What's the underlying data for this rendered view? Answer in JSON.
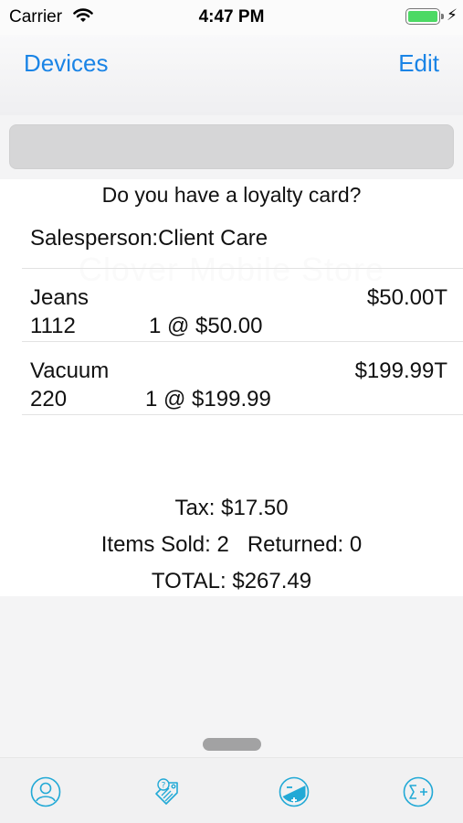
{
  "status_bar": {
    "carrier": "Carrier",
    "time": "4:47 PM"
  },
  "nav": {
    "left_button": "Devices",
    "right_button": "Edit"
  },
  "search": {
    "value": ""
  },
  "background_logo_text": "Clover Mobile Store",
  "loyalty_prompt": "Do you have a loyalty card?",
  "salesperson": "Salesperson:Client Care",
  "items": [
    {
      "name": "Jeans",
      "price": "$50.00T",
      "sku": "1112",
      "qty_price": "1 @ $50.00"
    },
    {
      "name": "Vacuum",
      "price": "$199.99T",
      "sku": "220",
      "qty_price": "1 @ $199.99"
    }
  ],
  "totals": {
    "tax": "Tax:  $17.50",
    "items_sold": "Items Sold: 2   Returned: 0",
    "total": "TOTAL: $267.49"
  },
  "tabs": [
    {
      "icon": "customer-icon"
    },
    {
      "icon": "price-tag-icon"
    },
    {
      "icon": "discount-icon"
    },
    {
      "icon": "add-sum-icon"
    }
  ],
  "colors": {
    "accent": "#1a84e6",
    "icon_cyan": "#22a9d6",
    "battery": "#4cd964"
  }
}
